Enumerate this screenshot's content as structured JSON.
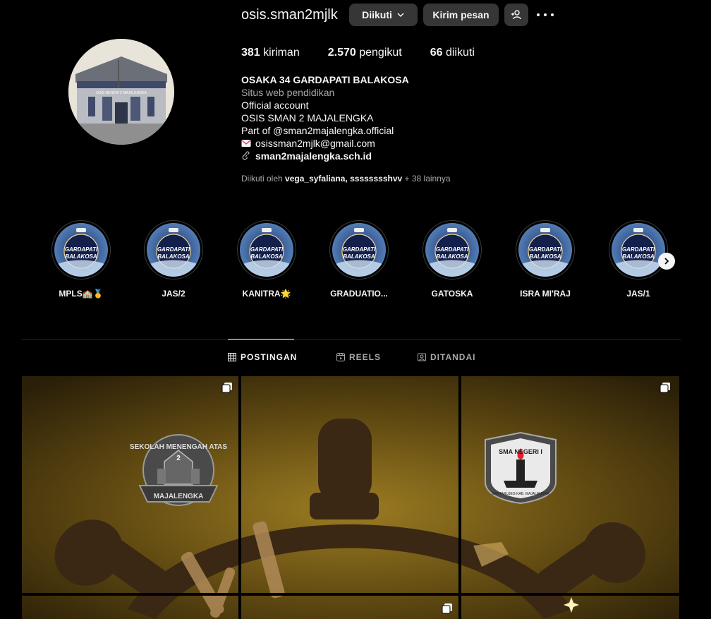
{
  "profile": {
    "username": "osis.sman2mjlk",
    "follow_label": "Diikuti",
    "message_label": "Kirim pesan"
  },
  "stats": {
    "posts_count": "381",
    "posts_label": "kiriman",
    "followers_count": "2.570",
    "followers_label": "pengikut",
    "following_count": "66",
    "following_label": "diikuti"
  },
  "bio": {
    "name": "OSAKA 34 GARDAPATI BALAKOSA",
    "category": "Situs web pendidikan",
    "line1": "Official account",
    "line2": "OSIS SMAN 2 MAJALENGKA",
    "line3": "Part of @sman2majalengka.official",
    "email": "osissman2mjlk@gmail.com",
    "link": "sman2majalengka.sch.id",
    "avatar_sign_text": "OSIS NEGERI 2 MAJALENGKA"
  },
  "followed_by": {
    "prefix": "Diikuti oleh",
    "users": "vega_syfaliana, sssssssshvv",
    "suffix": "+ 38 lainnya"
  },
  "highlights": [
    {
      "label": "MPLS🏫🥇"
    },
    {
      "label": "JAS/2"
    },
    {
      "label": "KANITRA🌟"
    },
    {
      "label": "GRADUATIO..."
    },
    {
      "label": "GATOSKA"
    },
    {
      "label": "ISRA MI'RAJ"
    },
    {
      "label": "JAS/1"
    }
  ],
  "highlight_cover_text": [
    "GARDAPATI",
    "BALAKOSA"
  ],
  "tabs": [
    {
      "label": "POSTINGAN"
    },
    {
      "label": "REELS"
    },
    {
      "label": "DITANDAI"
    }
  ],
  "grid": {
    "logo1_top": "SEKOLAH MENENGAH ATAS",
    "logo1_bottom": "MAJALENGKA",
    "logo1_number": "2",
    "logo2_top": "SMA NEGERI I",
    "logo2_bottom": "BANTARUJEG KAB. MAJALENGKA"
  },
  "colors": {
    "background": "#000000",
    "button": "#363636",
    "secondary_text": "#a8a8a8",
    "post_bg": "#6b5418"
  }
}
